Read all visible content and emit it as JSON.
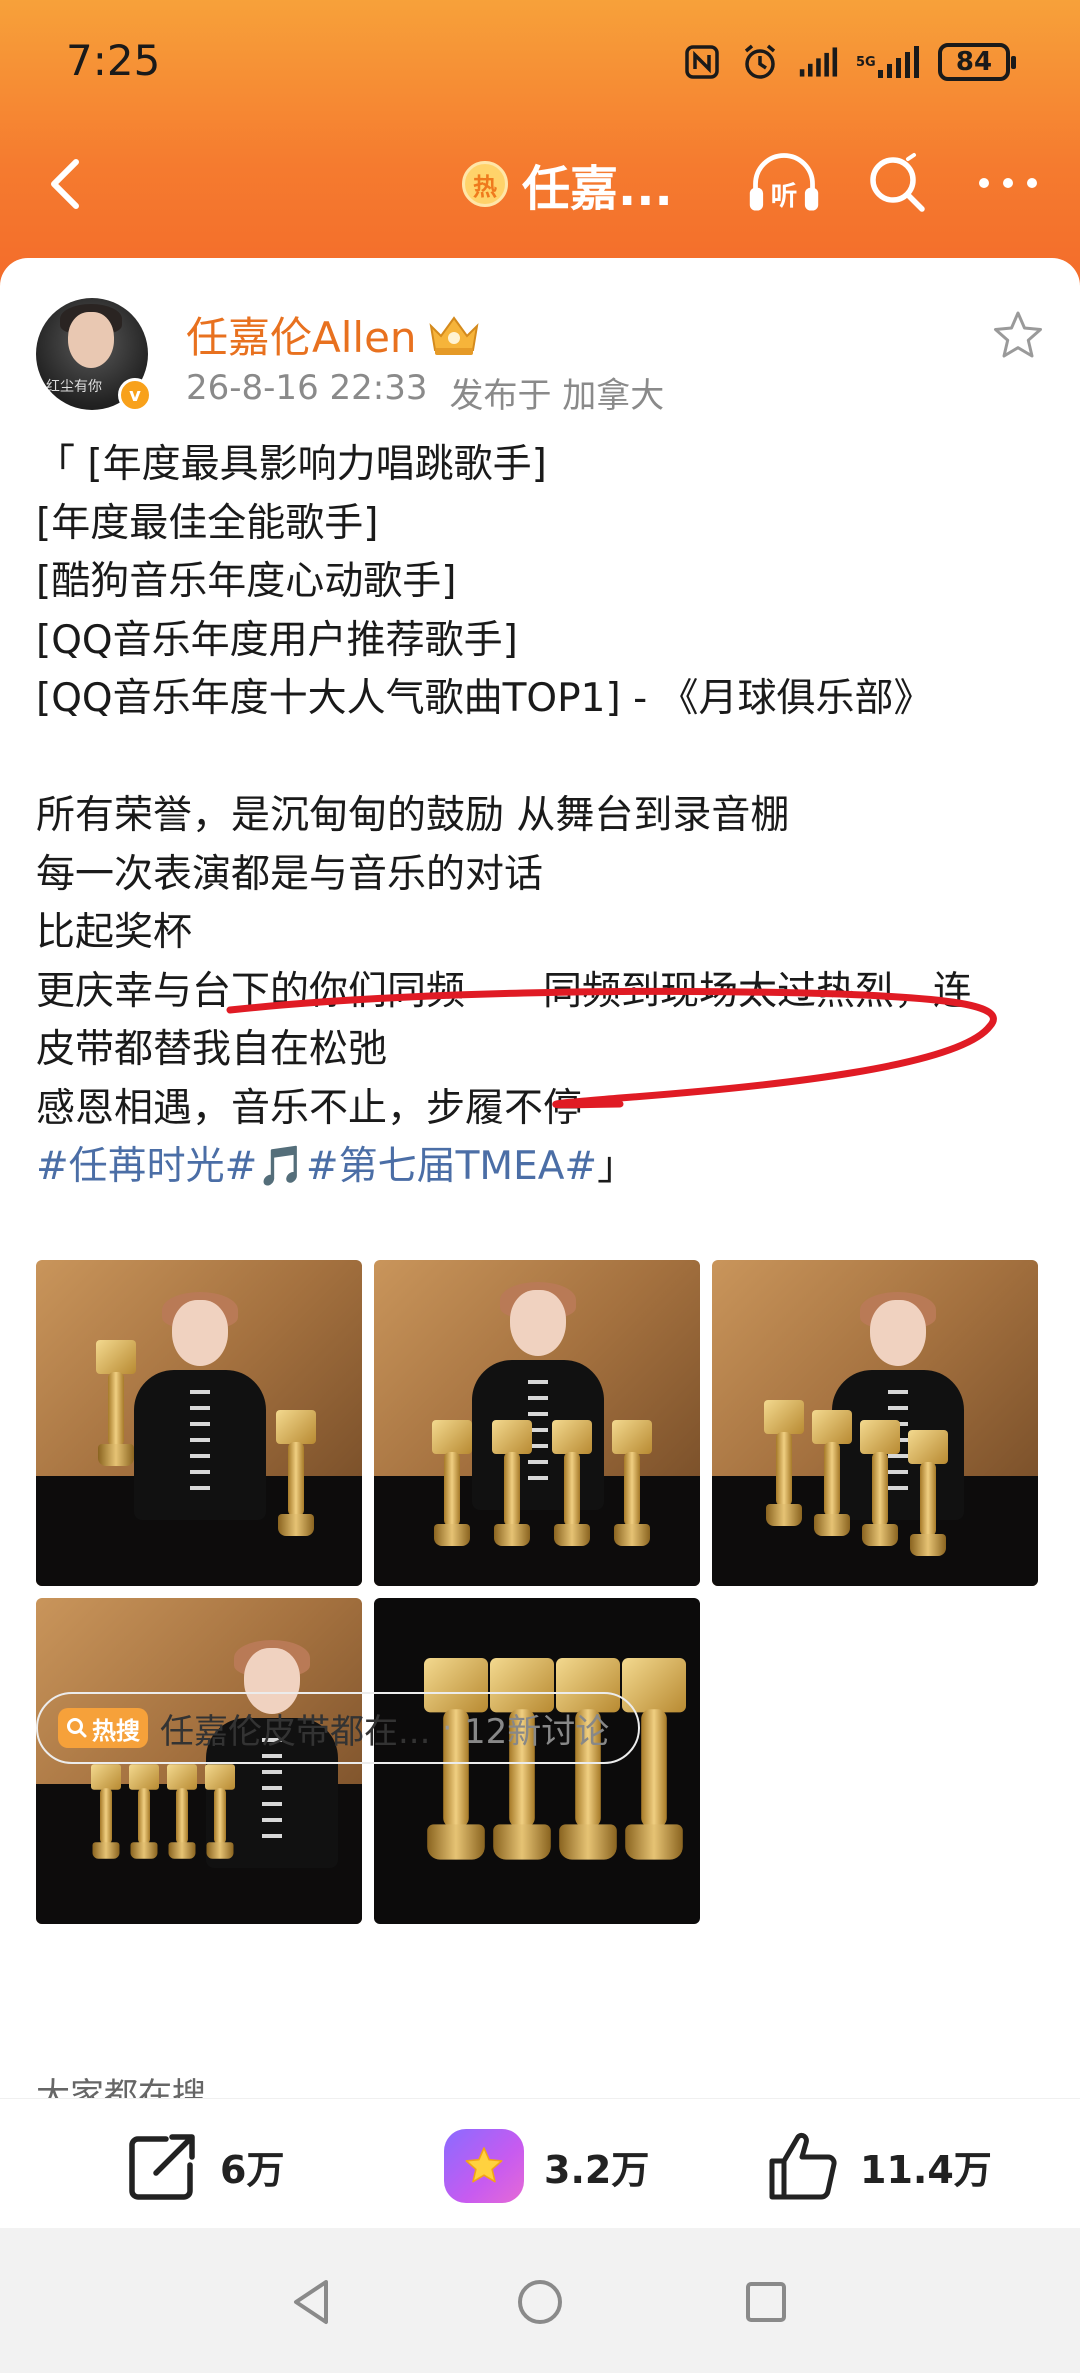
{
  "status_bar": {
    "time": "7:25",
    "battery": "84",
    "icons": [
      "nfc-icon",
      "alarm-icon",
      "signal-icon",
      "signal-icon"
    ]
  },
  "nav": {
    "hot_badge": "热",
    "title": "任嘉...",
    "icons": [
      "back-icon",
      "listen-icon",
      "search-icon",
      "more-icon"
    ],
    "listen_label": "听"
  },
  "post": {
    "author": "任嘉伦Allen",
    "date": "26-8-16 22:33",
    "location": "发布于 加拿大",
    "avatar_text": "红尘有你",
    "lines": [
      "「 [年度最具影响力唱跳歌手]",
      " [年度最佳全能歌手]",
      " [酷狗音乐年度心动歌手]",
      " [QQ音乐年度用户推荐歌手]",
      " [QQ音乐年度十大人气歌曲TOP1] - 《月球俱乐部》",
      "",
      " 所有荣誉，是沉甸甸的鼓励 从舞台到录音棚",
      " 每一次表演都是与音乐的对话",
      " 比起奖杯",
      " 更庆幸与台下的你们同频——同频到现场太过热烈，连皮带都替我自在松弛",
      " 感恩相遇，音乐不止，步履不停"
    ],
    "hashtag_1": "#任苒时光#",
    "hashtag_2": "#第七届TMEA#",
    "closing_quote": "」",
    "photos": [
      "photo-1",
      "photo-2",
      "photo-3",
      "photo-4",
      "photo-5"
    ]
  },
  "hot_search": {
    "badge": "热搜",
    "text": "任嘉伦皮带都在...",
    "separator": "·",
    "count": "12新讨论"
  },
  "everyone_search": "大家都在搜",
  "actions": {
    "repost": "6万",
    "star": "3.2万",
    "like": "11.4万"
  },
  "colors": {
    "header_orange": "#f57b2f",
    "username_orange": "#e8711f",
    "hashtag_blue": "#4b6ea6",
    "highlight_red": "#e01b24"
  }
}
